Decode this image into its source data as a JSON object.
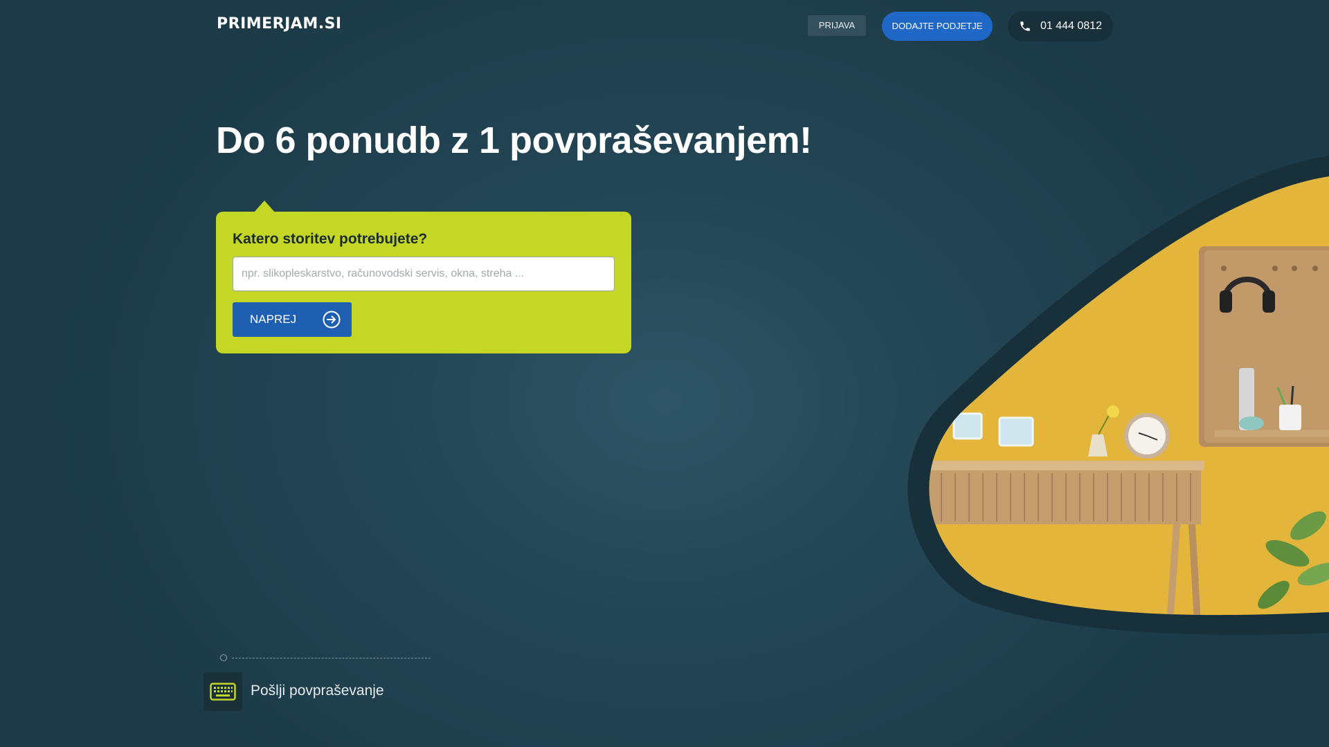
{
  "header": {
    "logo": "PRIMERJAM.SI",
    "login_label": "PRIJAVA",
    "add_company_label": "DODAJTE PODJETJE",
    "phone": "01 444 0812"
  },
  "hero": {
    "headline": "Do 6 ponudb z 1 povpraševanjem!"
  },
  "form": {
    "question": "Katero storitev potrebujete?",
    "placeholder": "npr. slikopleskarstvo, računovodski servis, okna, streha ...",
    "value": "",
    "submit_label": "NAPREJ"
  },
  "steps": {
    "current_label": "Pošlji povpraševanje",
    "current_icon": "keyboard-icon"
  },
  "colors": {
    "accent": "#c4d626",
    "primary_button": "#1f5fb2",
    "background": "#234655"
  }
}
